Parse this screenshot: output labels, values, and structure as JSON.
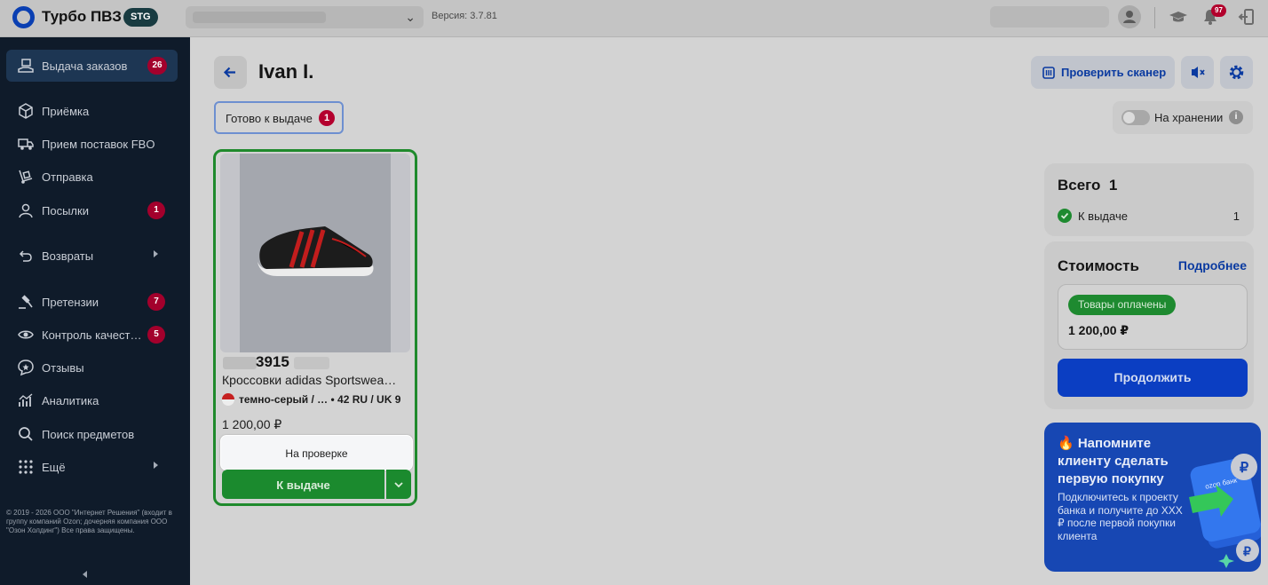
{
  "topbar": {
    "brand": "Турбо ПВЗ",
    "env_badge": "STG",
    "version": "Версия: 3.7.81",
    "notifications_count": "97"
  },
  "sidebar": {
    "items": [
      {
        "label": "Выдача заказов",
        "badge": "26",
        "icon": "hand-box-icon"
      },
      {
        "label": "Приёмка",
        "badge": "",
        "icon": "box-icon"
      },
      {
        "label": "Прием поставок FBO",
        "badge": "",
        "icon": "truck-icon"
      },
      {
        "label": "Отправка",
        "badge": "",
        "icon": "dolly-icon"
      },
      {
        "label": "Посылки",
        "badge": "1",
        "icon": "person-icon"
      },
      {
        "label": "Возвраты",
        "badge": "",
        "icon": "return-icon"
      },
      {
        "label": "Претензии",
        "badge": "7",
        "icon": "gavel-icon"
      },
      {
        "label": "Контроль качест…",
        "badge": "5",
        "icon": "eye-icon"
      },
      {
        "label": "Отзывы",
        "badge": "",
        "icon": "review-icon"
      },
      {
        "label": "Аналитика",
        "badge": "",
        "icon": "analytics-icon"
      },
      {
        "label": "Поиск предметов",
        "badge": "",
        "icon": "search-icon"
      },
      {
        "label": "Ещё",
        "badge": "",
        "icon": "grid-icon"
      }
    ],
    "copyright": "© 2019 - 2026 ООО \"Интернет Решения\" (входит в группу компаний Ozon; дочерняя компания ООО \"Озон Холдинг\") Все права защищены."
  },
  "header": {
    "title": "Ivan I.",
    "check_scanner": "Проверить сканер"
  },
  "filters": {
    "status_label": "Готово к выдаче",
    "status_count": "1",
    "storage_label": "На хранении",
    "info": "i"
  },
  "product": {
    "code": "3915",
    "name": "Кроссовки adidas Sportswea…",
    "variant": "темно-серый / … • 42 RU / UK 9",
    "price": "1 200,00 ₽",
    "checking_label": "На проверке",
    "issue_label": "К выдаче"
  },
  "summary": {
    "total_label": "Всего",
    "total_count": "1",
    "ready_label": "К выдаче",
    "ready_count": "1"
  },
  "cost": {
    "title": "Стоимость",
    "more": "Подробнее",
    "paid_chip": "Товары оплачены",
    "paid_sum": "1 200,00 ₽",
    "continue": "Продолжить"
  },
  "promo": {
    "title": "🔥 Напомните клиенту сделать первую покупку",
    "text": "Подключитесь к проекту банка и получите до ХХХ ₽ после первой покупки клиента",
    "card_brand": "ozon банк"
  }
}
